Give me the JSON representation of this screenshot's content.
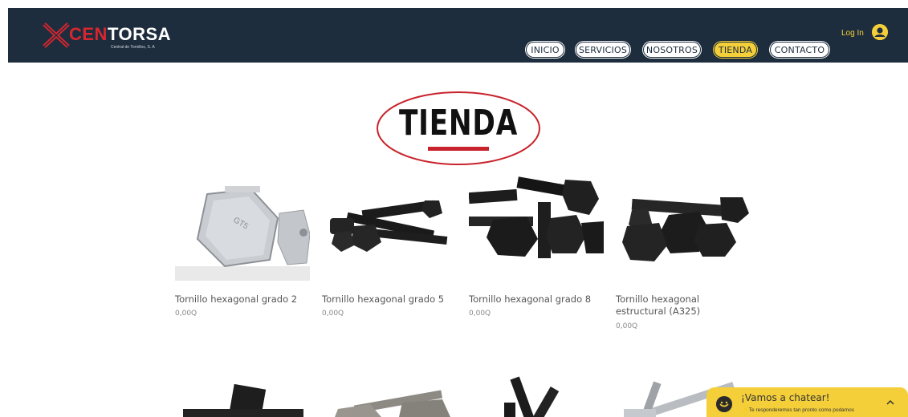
{
  "header": {
    "logo": {
      "brand_prefix": "CEN",
      "brand_suffix": "TORSA",
      "tagline": "Central de Tornillos, S. A"
    },
    "nav": [
      {
        "label": "INICIO",
        "active": false
      },
      {
        "label": "SERVICIOS",
        "active": false
      },
      {
        "label": "NOSOTROS",
        "active": false
      },
      {
        "label": "TIENDA",
        "active": true
      },
      {
        "label": "CONTACTO",
        "active": false
      }
    ],
    "login_label": "Log In",
    "avatar_icon": "user-circle-icon"
  },
  "page": {
    "title": "TIENDA"
  },
  "products": [
    {
      "name": "Tornillo hexagonal grado 2",
      "price": "0,00Q"
    },
    {
      "name": "Tornillo hexagonal grado 5",
      "price": "0,00Q"
    },
    {
      "name": "Tornillo hexagonal grado 8",
      "price": "0,00Q"
    },
    {
      "name": "Tornillo hexagonal estructural (A325)",
      "price": "0,00Q"
    }
  ],
  "chat": {
    "title": "¡Vamos a chatear!",
    "subtitle": "Te responderemos tan pronto como podamos",
    "icon": "chat-bot-icon",
    "toggle_icon": "chevron-up-icon"
  },
  "colors": {
    "header_bg": "#1e2d3d",
    "accent_yellow": "#f4cf3a",
    "brand_red": "#d7262f"
  }
}
